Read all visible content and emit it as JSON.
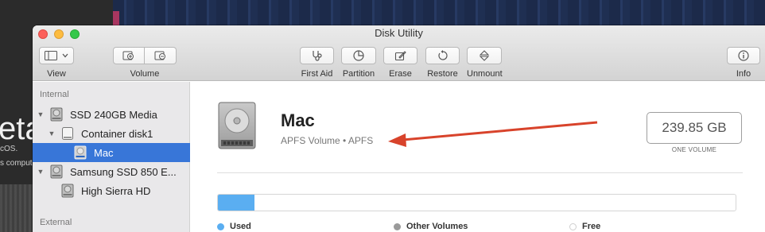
{
  "background": {
    "big_text": "eta",
    "line1": "cOS.",
    "line2": "s computer"
  },
  "window": {
    "title": "Disk Utility"
  },
  "toolbar": {
    "view_label": "View",
    "volume_label": "Volume",
    "first_aid_label": "First Aid",
    "partition_label": "Partition",
    "erase_label": "Erase",
    "restore_label": "Restore",
    "unmount_label": "Unmount",
    "info_label": "Info"
  },
  "sidebar": {
    "internal_header": "Internal",
    "external_header": "External",
    "items": [
      {
        "label": "SSD 240GB Media",
        "icon": "internal-disk-icon"
      },
      {
        "label": "Container disk1",
        "icon": "container-icon"
      },
      {
        "label": "Mac",
        "icon": "apfs-volume-icon",
        "selected": true
      },
      {
        "label": "Samsung SSD 850 E...",
        "icon": "internal-disk-icon"
      },
      {
        "label": "High Sierra HD",
        "icon": "volume-icon"
      }
    ]
  },
  "volume": {
    "name": "Mac",
    "subtitle": "APFS Volume • APFS",
    "size": "239.85 GB",
    "size_caption": "ONE VOLUME",
    "used_fraction": 0.07
  },
  "legend": {
    "used": "Used",
    "other": "Other Volumes",
    "free": "Free"
  },
  "colors": {
    "used": "#5aaef1",
    "other": "#9a9a9a",
    "free": "#ffffff",
    "selection": "#3876d8",
    "annotation_arrow": "#d8432b"
  }
}
